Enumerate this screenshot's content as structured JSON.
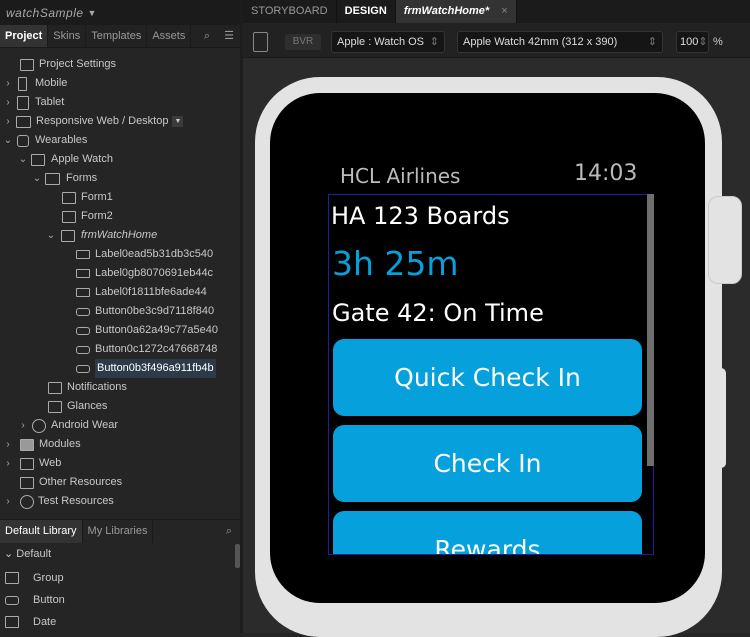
{
  "project": {
    "name": "watchSample"
  },
  "left_tabs": [
    "Project",
    "Skins",
    "Templates",
    "Assets"
  ],
  "tree": [
    {
      "label": "Project Settings"
    },
    {
      "label": "Mobile"
    },
    {
      "label": "Tablet"
    },
    {
      "label": "Responsive Web / Desktop"
    },
    {
      "label": "Wearables"
    },
    {
      "label": "Apple Watch"
    },
    {
      "label": "Forms"
    },
    {
      "label": "Form1"
    },
    {
      "label": "Form2"
    },
    {
      "label": "frmWatchHome"
    },
    {
      "label": "Label0ead5b31db3c540"
    },
    {
      "label": "Label0gb8070691eb44c"
    },
    {
      "label": "Label0f1811bfe6ade44"
    },
    {
      "label": "Button0be3c9d7118f840"
    },
    {
      "label": "Button0a62a49c77a5e40"
    },
    {
      "label": "Button0c1272c47668748"
    },
    {
      "label": "Button0b3f496a911fb4b"
    },
    {
      "label": "Notifications"
    },
    {
      "label": "Glances"
    },
    {
      "label": "Android Wear"
    },
    {
      "label": "Modules"
    },
    {
      "label": "Web"
    },
    {
      "label": "Other Resources"
    },
    {
      "label": "Test Resources"
    }
  ],
  "library": {
    "tabs": [
      "Default Library",
      "My Libraries"
    ],
    "section": "Default",
    "items": [
      "Group",
      "Button",
      "Date"
    ]
  },
  "editor_tabs": [
    "STORYBOARD",
    "DESIGN",
    "frmWatchHome*"
  ],
  "toolbar": {
    "bvr": "BVR",
    "platform": "Apple : Watch OS",
    "device": "Apple Watch 42mm (312 x 390)",
    "zoom": "100",
    "zoom_unit": "%"
  },
  "watch": {
    "title": "HCL Airlines",
    "time": "14:03",
    "flight": "HA 123 Boards",
    "countdown": "3h 25m",
    "gate": "Gate 42: On Time",
    "buttons": [
      "Quick Check In",
      "Check In",
      "Rewards"
    ]
  },
  "colors": {
    "accent": "#06a0dc"
  }
}
